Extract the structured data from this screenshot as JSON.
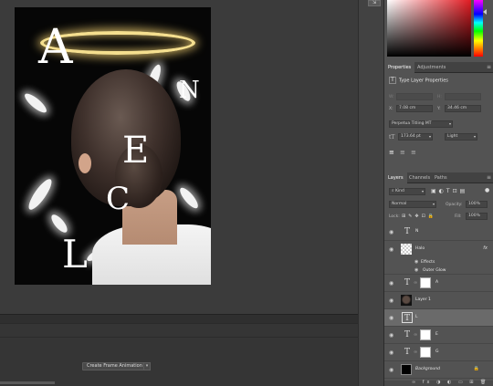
{
  "canvas": {
    "letters": [
      "A",
      "N",
      "E",
      "C",
      "L"
    ],
    "create_button": "Create Frame Animation"
  },
  "properties_panel": {
    "tabs": [
      "Properties",
      "Adjustments"
    ],
    "title": "Type Layer Properties",
    "w_label": "W:",
    "h_label": "H:",
    "x_label": "X:",
    "y_label": "Y:",
    "x_value": "7.08 cm",
    "y_value": "34.46 cm",
    "font_family": "Perpetua Titling MT",
    "font_size": "173.64 pt",
    "font_style": "Light"
  },
  "layers_panel": {
    "tabs": [
      "Layers",
      "Channels",
      "Paths"
    ],
    "filter_kind": "Kind",
    "blend_mode": "Normal",
    "opacity_label": "Opacity:",
    "opacity_value": "100%",
    "lock_label": "Lock:",
    "fill_label": "Fill:",
    "fill_value": "100%",
    "layers": [
      {
        "name": "N",
        "type": "text",
        "thumb": "T"
      },
      {
        "name": "Halo",
        "type": "fx",
        "thumb": ""
      },
      {
        "name": "Effects",
        "type": "effects-header"
      },
      {
        "name": "Outer Glow",
        "type": "effect"
      },
      {
        "name": "A",
        "type": "text-mask",
        "thumb": "T"
      },
      {
        "name": "Layer 1",
        "type": "image",
        "thumb": ""
      },
      {
        "name": "L",
        "type": "text",
        "thumb": "T"
      },
      {
        "name": "E",
        "type": "text-mask",
        "thumb": "T"
      },
      {
        "name": "G",
        "type": "text-mask",
        "thumb": "T"
      },
      {
        "name": "Background",
        "type": "background",
        "thumb": ""
      }
    ]
  },
  "colors": {
    "panel_bg": "#535353",
    "canvas_bg": "#3b3b3b",
    "halo": "#f5df8f",
    "selected_row": "#6a6a6a"
  }
}
